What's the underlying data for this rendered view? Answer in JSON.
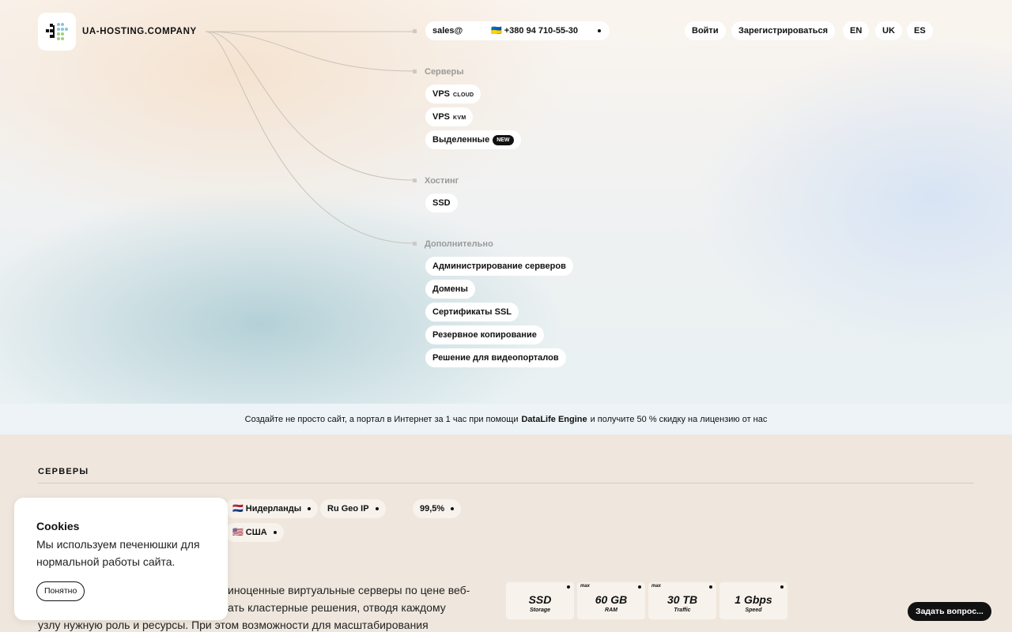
{
  "header": {
    "logo_text": "UA-HOSTING.COMPANY",
    "email": "sales@",
    "phone": "🇺🇦 +380 94 710-55-30",
    "login": "Войти",
    "register": "Зарегистрироваться",
    "languages": [
      "EN",
      "UK",
      "ES"
    ]
  },
  "menu": {
    "servers": {
      "label": "Серверы",
      "items": [
        {
          "label": "VPS",
          "tag": "CLOUD"
        },
        {
          "label": "VPS",
          "tag": "KVM"
        },
        {
          "label": "Выделенные",
          "tag": "NEW"
        }
      ]
    },
    "hosting": {
      "label": "Хостинг",
      "items": [
        {
          "label": "SSD"
        }
      ]
    },
    "extra": {
      "label": "Дополнительно",
      "items": [
        {
          "label": "Администрирование серверов"
        },
        {
          "label": "Домены"
        },
        {
          "label": "Сертификаты SSL"
        },
        {
          "label": "Резервное копирование"
        },
        {
          "label": "Решение для видеопорталов"
        }
      ]
    }
  },
  "promo": {
    "before": "Создайте не просто сайт, а портал в Интернет за 1 час при помощи",
    "highlight": "DataLife Engine",
    "after": "и получите 50 % скидку на лицензию от нас"
  },
  "servers_section": {
    "title": "СЕРВЕРЫ",
    "locations": [
      "🇳🇱 Нидерланды",
      "Ru Geo IP",
      "🇺🇸 США"
    ],
    "uptime": "99,5%",
    "description": "…иноценные виртуальные серверы по цене веб-…ать кластерные решения, отводя каждому узлу нужную роль и ресурсы. При этом возможности для масштабирования",
    "description_lines": [
      "иноценные виртуальные серверы по цене веб-",
      "ать кластерные решения, отводя каждому",
      "узлу нужную роль и ресурсы. При этом возможности для масштабирования"
    ],
    "specs": [
      {
        "max": "",
        "value": "SSD",
        "caption": "Storage"
      },
      {
        "max": "max",
        "value": "60 GB",
        "caption": "RAM"
      },
      {
        "max": "max",
        "value": "30 TB",
        "caption": "Traffic"
      },
      {
        "max": "",
        "value": "1 Gbps",
        "caption": "Speed"
      }
    ]
  },
  "cookie": {
    "title": "Cookies",
    "text": "Мы используем печенюшки для нормальной работы сайта.",
    "button": "Понятно"
  },
  "ask_button": "Задать вопрос...",
  "colors": {
    "page_bg": "#efe7dd",
    "promo_bg": "#edf3f6",
    "accent_dark": "#111111",
    "label_gray": "#9a9a9a"
  }
}
